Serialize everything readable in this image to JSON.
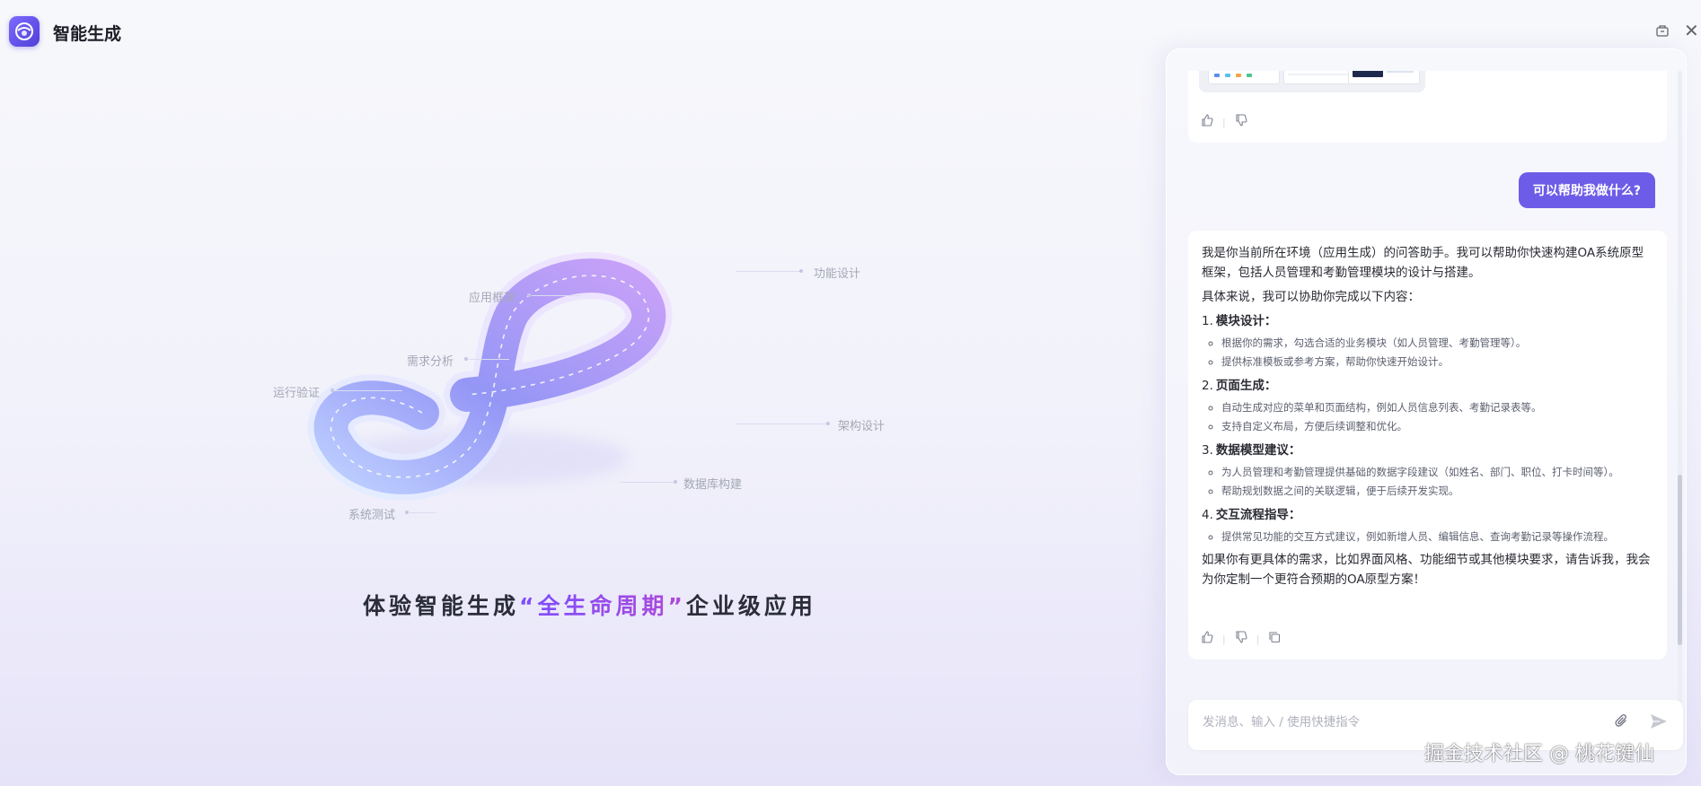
{
  "header": {
    "title": "智能生成"
  },
  "hero": {
    "labels": [
      "功能设计",
      "应用框架",
      "需求分析",
      "运行验证",
      "架构设计",
      "数据库构建",
      "系统测试"
    ],
    "slogan_pre": "体验智能生成",
    "slogan_highlight": "“全生命周期”",
    "slogan_post": "企业级应用"
  },
  "chat": {
    "user_message": "可以帮助我做什么?",
    "reply": {
      "intro": "我是你当前所在环境（应用生成）的问答助手。我可以帮助你快速构建OA系统原型框架，包括人员管理和考勤管理模块的设计与搭建。",
      "lead": "具体来说，我可以协助你完成以下内容：",
      "sections": [
        {
          "num": "1.",
          "title": "模块设计：",
          "items": [
            "根据你的需求，勾选合适的业务模块（如人员管理、考勤管理等）。",
            "提供标准模板或参考方案，帮助你快速开始设计。"
          ]
        },
        {
          "num": "2.",
          "title": "页面生成：",
          "items": [
            "自动生成对应的菜单和页面结构，例如人员信息列表、考勤记录表等。",
            "支持自定义布局，方便后续调整和优化。"
          ]
        },
        {
          "num": "3.",
          "title": "数据模型建议：",
          "items": [
            "为人员管理和考勤管理提供基础的数据字段建议（如姓名、部门、职位、打卡时间等）。",
            "帮助规划数据之间的关联逻辑，便于后续开发实现。"
          ]
        },
        {
          "num": "4.",
          "title": "交互流程指导：",
          "items": [
            "提供常见功能的交互方式建议，例如新增人员、编辑信息、查询考勤记录等操作流程。"
          ]
        }
      ],
      "closing": "如果你有更具体的需求，比如界面风格、功能细节或其他模块要求，请告诉我，我会为你定制一个更符合预期的OA原型方案！"
    },
    "input": {
      "placeholder": "发消息、输入 / 使用快捷指令",
      "value": ""
    }
  },
  "icons": {
    "like": "thumb-up-icon",
    "dislike": "thumb-down-icon",
    "copy": "copy-icon",
    "attach": "paperclip-icon",
    "send": "send-icon",
    "pin": "pin-icon",
    "close": "close-icon"
  },
  "watermark": "掘金技术社区 @ 桃花键仙",
  "colors": {
    "accent": "#6d5ce7",
    "loop_start": "#8fa8ff",
    "loop_end": "#b48cf5"
  }
}
